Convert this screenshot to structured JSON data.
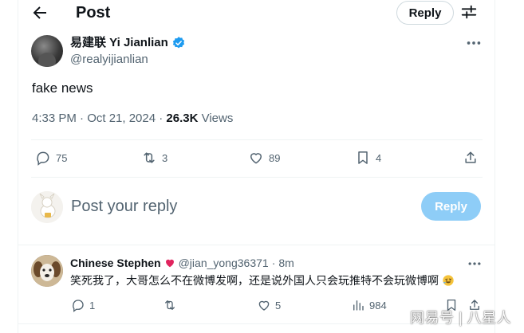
{
  "header": {
    "title": "Post",
    "reply_label": "Reply"
  },
  "tweet": {
    "author_name": "易建联 Yi Jianlian",
    "author_handle": "@realyijianlian",
    "text": "fake news",
    "timestamp": "4:33 PM · Oct 21, 2024 · ",
    "views_count": "26.3K",
    "views_label": " Views",
    "stats": {
      "replies": "75",
      "reposts": "3",
      "likes": "89",
      "bookmarks": "4"
    }
  },
  "composer": {
    "placeholder": "Post your reply",
    "reply_label": "Reply"
  },
  "reply": {
    "author_name": "Chinese Stephen",
    "author_handle": "@jian_yong36371",
    "separator": "·",
    "time": "8m",
    "text": "笑死我了，大哥怎么不在微博发啊，还是说外国人只会玩推特不会玩微博啊",
    "stats": {
      "replies": "1",
      "likes": "5",
      "views": "984"
    }
  },
  "watermark": "网易号 | 八星人",
  "colors": {
    "accent": "#1d9bf0",
    "reply_disabled": "#8ecdf7",
    "secondary_text": "#536471",
    "heart_emoji": "#e0245e"
  }
}
